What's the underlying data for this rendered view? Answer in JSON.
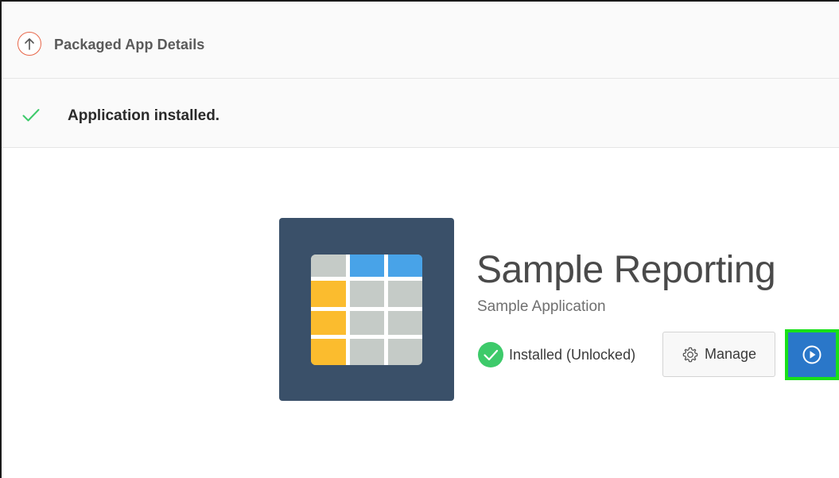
{
  "header": {
    "title": "Packaged App Details",
    "back_icon": "arrow-up-circle-icon"
  },
  "notice": {
    "message": "Application installed.",
    "icon": "check-icon"
  },
  "app": {
    "name": "Sample Reporting",
    "description": "Sample Application",
    "status": "Installed (Unlocked)",
    "status_icon": "check-circle-icon",
    "icon": "table-report-icon"
  },
  "actions": {
    "manage_label": "Manage",
    "manage_icon": "gear-icon",
    "run_icon": "play-circle-icon"
  },
  "colors": {
    "accent": "#2a77c9",
    "tile": "#3a5069",
    "success": "#3dca6a",
    "back": "#e8674a",
    "highlight": "#18e018"
  }
}
